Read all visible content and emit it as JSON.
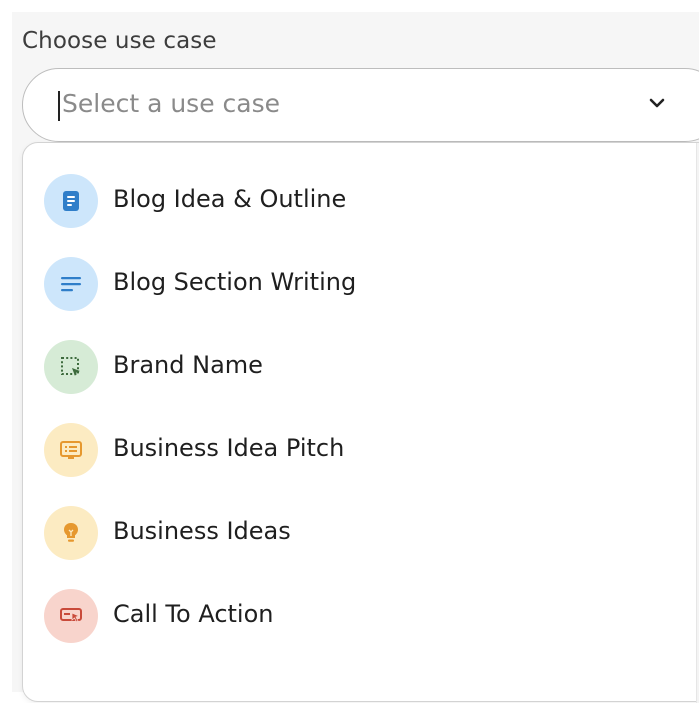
{
  "form": {
    "label": "Choose use case",
    "placeholder": "Select a use case"
  },
  "options": [
    {
      "label": "Blog Idea & Outline",
      "icon": "document-icon",
      "icon_bg": "#cde6fb",
      "icon_color": "#2f7ec9"
    },
    {
      "label": "Blog Section Writing",
      "icon": "lines-icon",
      "icon_bg": "#cde6fb",
      "icon_color": "#2f7ec9"
    },
    {
      "label": "Brand Name",
      "icon": "selection-cursor-icon",
      "icon_bg": "#d6ebd6",
      "icon_color": "#3d6b3d"
    },
    {
      "label": "Business Idea Pitch",
      "icon": "presentation-icon",
      "icon_bg": "#fcebc2",
      "icon_color": "#e6982e"
    },
    {
      "label": "Business Ideas",
      "icon": "lightbulb-icon",
      "icon_bg": "#fcebc2",
      "icon_color": "#e6982e"
    },
    {
      "label": "Call To Action",
      "icon": "click-icon",
      "icon_bg": "#f8d4cc",
      "icon_color": "#c94a3a"
    }
  ]
}
